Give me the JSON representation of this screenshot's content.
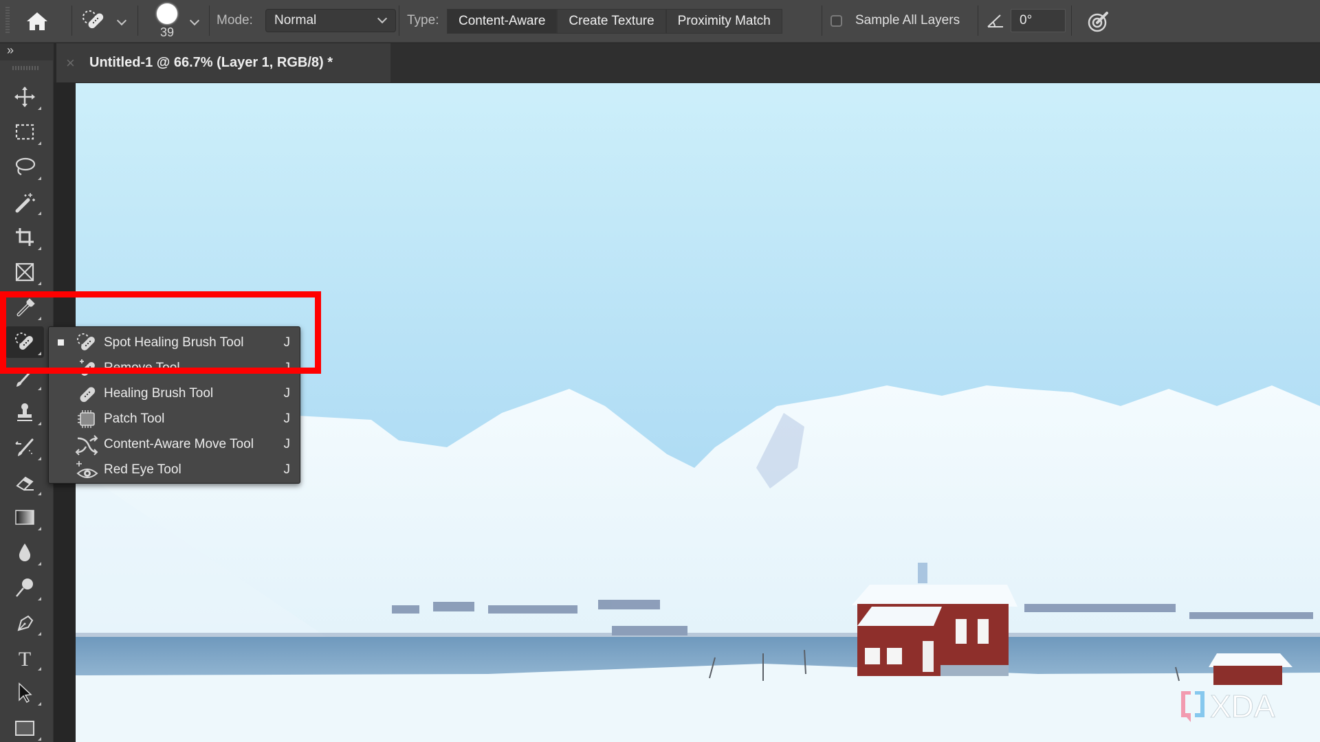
{
  "options_bar": {
    "home_icon": "home-icon",
    "tool_preset_icon": "spot-healing-brush-icon",
    "brush_size": "39",
    "mode_label": "Mode:",
    "mode_value": "Normal",
    "type_label": "Type:",
    "type_options": [
      {
        "label": "Content-Aware",
        "selected": true
      },
      {
        "label": "Create Texture",
        "selected": false
      },
      {
        "label": "Proximity Match",
        "selected": false
      }
    ],
    "sample_all_layers_label": "Sample All Layers",
    "sample_all_layers_checked": false,
    "angle_icon": "angle-icon",
    "angle_value": "0°",
    "pressure_icon": "pressure-size-icon"
  },
  "panel_toggle": "»",
  "document_tab": {
    "close": "×",
    "title": "Untitled-1 @ 66.7% (Layer 1, RGB/8) *"
  },
  "toolbar": {
    "tools": [
      {
        "name": "move-tool",
        "icon": "move-icon"
      },
      {
        "name": "rectangular-marquee-tool",
        "icon": "marquee-icon"
      },
      {
        "name": "lasso-tool",
        "icon": "lasso-icon"
      },
      {
        "name": "magic-wand-tool",
        "icon": "magic-wand-icon"
      },
      {
        "name": "crop-tool",
        "icon": "crop-icon"
      },
      {
        "name": "frame-tool",
        "icon": "frame-icon"
      },
      {
        "name": "eyedropper-tool",
        "icon": "eyedropper-icon"
      },
      {
        "name": "spot-healing-brush-tool",
        "icon": "spot-healing-brush-icon",
        "active": true
      },
      {
        "name": "brush-tool",
        "icon": "brush-icon"
      },
      {
        "name": "clone-stamp-tool",
        "icon": "stamp-icon"
      },
      {
        "name": "history-brush-tool",
        "icon": "history-brush-icon"
      },
      {
        "name": "eraser-tool",
        "icon": "eraser-icon"
      },
      {
        "name": "gradient-tool",
        "icon": "gradient-icon"
      },
      {
        "name": "blur-tool",
        "icon": "blur-drop-icon"
      },
      {
        "name": "dodge-tool",
        "icon": "dodge-icon"
      },
      {
        "name": "pen-tool",
        "icon": "pen-icon"
      },
      {
        "name": "type-tool",
        "icon": "type-icon"
      },
      {
        "name": "path-selection-tool",
        "icon": "arrow-icon"
      },
      {
        "name": "rectangle-tool",
        "icon": "rectangle-icon"
      }
    ]
  },
  "flyout_menu": {
    "items": [
      {
        "label": "Spot Healing Brush Tool",
        "shortcut": "J",
        "selected": true,
        "icon": "spot-healing-brush-icon"
      },
      {
        "label": "Remove Tool",
        "shortcut": "J",
        "selected": false,
        "icon": "remove-tool-icon"
      },
      {
        "label": "Healing Brush Tool",
        "shortcut": "J",
        "selected": false,
        "icon": "healing-brush-icon"
      },
      {
        "label": "Patch Tool",
        "shortcut": "J",
        "selected": false,
        "icon": "patch-icon"
      },
      {
        "label": "Content-Aware Move Tool",
        "shortcut": "J",
        "selected": false,
        "icon": "content-aware-move-icon"
      },
      {
        "label": "Red Eye Tool",
        "shortcut": "J",
        "selected": false,
        "icon": "red-eye-icon"
      }
    ]
  },
  "annotation": {
    "color": "#ff0000"
  },
  "watermark": {
    "text": "XDA",
    "bracket_colors": [
      "#f29bb0",
      "#86c8ee"
    ]
  },
  "colors": {
    "ui_bg": "#474747",
    "toolbar_bg": "#3e3e3e",
    "menu_bg": "#474747",
    "sky_top": "#cdeffa",
    "sky_bottom": "#a6d6f2",
    "house_red": "#8e2f2b",
    "water": "#7fa8c9"
  }
}
